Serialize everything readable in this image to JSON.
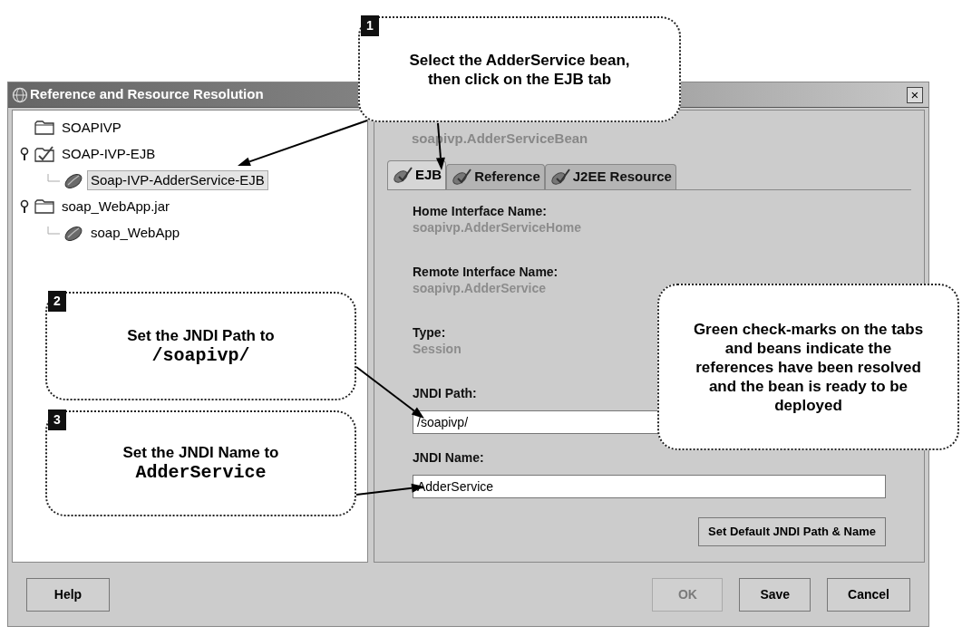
{
  "window": {
    "title": "Reference and Resource Resolution",
    "close": "×"
  },
  "tree": [
    {
      "label": "SOAPIVP",
      "kind": "folder",
      "selected": false
    },
    {
      "label": "SOAP-IVP-EJB",
      "kind": "checked-folder",
      "selected": false,
      "children": [
        {
          "label": "Soap-IVP-AdderService-EJB",
          "kind": "bean",
          "selected": true
        }
      ]
    },
    {
      "label": "soap_WebApp.jar",
      "kind": "folder",
      "selected": false,
      "children": [
        {
          "label": "soap_WebApp",
          "kind": "bean",
          "selected": false
        }
      ]
    }
  ],
  "detail": {
    "bean_name": "soapivp.AdderServiceBean",
    "tabs": [
      {
        "label": "EJB",
        "selected": true
      },
      {
        "label": "Reference",
        "selected": false
      },
      {
        "label": "J2EE Resource",
        "selected": false
      }
    ],
    "fields": [
      {
        "label": "Home Interface Name:",
        "value": "soapivp.AdderServiceHome",
        "kind": "readonly"
      },
      {
        "label": "Remote Interface Name:",
        "value": "soapivp.AdderService",
        "kind": "readonly"
      },
      {
        "label": "Type:",
        "value": "Session",
        "kind": "readonly"
      },
      {
        "label": "JNDI Path:",
        "value": "/soapivp/",
        "kind": "input"
      },
      {
        "label": "JNDI Name:",
        "value": "AdderService",
        "kind": "input"
      }
    ],
    "default_button": "Set Default JNDI Path & Name"
  },
  "footer": {
    "left": [
      {
        "label": "Help",
        "disabled": false
      }
    ],
    "right": [
      {
        "label": "OK",
        "disabled": true
      },
      {
        "label": "Save",
        "disabled": false
      },
      {
        "label": "Cancel",
        "disabled": false
      }
    ]
  },
  "callouts": [
    {
      "number": "1",
      "text": "Select the AdderService bean, then click on the EJB tab"
    },
    {
      "number": "2",
      "text": "Set the JNDI Path to",
      "code": "/soapivp/"
    },
    {
      "number": "3",
      "text": "Set the JNDI Name to",
      "code": "AdderService"
    },
    {
      "text": "Green check-marks on the tabs and beans indicate the references have been resolved and the bean is ready to be deployed"
    }
  ]
}
